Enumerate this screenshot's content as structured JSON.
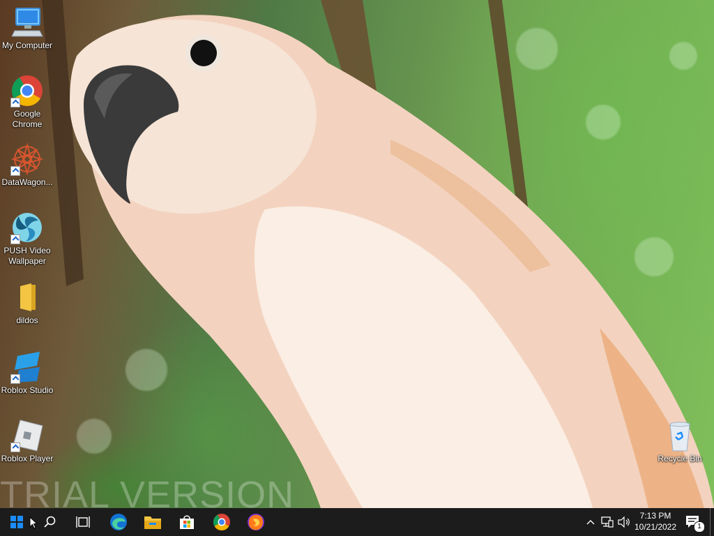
{
  "desktop": {
    "watermark": "TRIAL VERSION",
    "icons": [
      {
        "label": "My Computer"
      },
      {
        "label": "Google\nChrome"
      },
      {
        "label": "DataWagon..."
      },
      {
        "label": "PUSH Video\nWallpaper"
      },
      {
        "label": "dildos"
      },
      {
        "label": "Roblox Studio"
      },
      {
        "label": "Roblox Player"
      },
      {
        "label": "Recycle Bin"
      }
    ]
  },
  "taskbar": {
    "time": "7:13 PM",
    "date": "10/21/2022",
    "notification_count": "1",
    "pinned": [
      "start-icon",
      "search-icon",
      "task-view-icon",
      "edge-icon",
      "file-explorer-icon",
      "store-icon",
      "chrome-icon",
      "firefox-icon"
    ]
  },
  "colors": {
    "taskbar": "#1c1c1c",
    "accent": "#1a8cff"
  }
}
